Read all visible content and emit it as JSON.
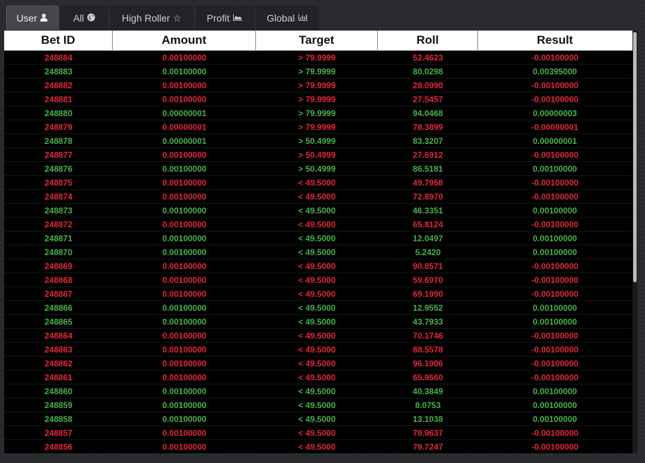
{
  "tabs": [
    {
      "label": "User",
      "icon": "user-icon",
      "active": true
    },
    {
      "label": "All",
      "icon": "globe-icon",
      "active": false
    },
    {
      "label": "High Roller",
      "icon": "star-icon",
      "active": false
    },
    {
      "label": "Profit",
      "icon": "area-chart-icon",
      "active": false
    },
    {
      "label": "Global",
      "icon": "bar-chart-icon",
      "active": false
    }
  ],
  "table": {
    "headers": [
      "Bet ID",
      "Amount",
      "Target",
      "Roll",
      "Result"
    ],
    "rows": [
      {
        "id": "248884",
        "amount": "0.00100000",
        "target": "> 79.9999",
        "roll": "52.4623",
        "result": "-0.00100000",
        "status": "loss"
      },
      {
        "id": "248883",
        "amount": "0.00100000",
        "target": "> 79.9999",
        "roll": "80.0298",
        "result": "0.00395000",
        "status": "win"
      },
      {
        "id": "248882",
        "amount": "0.00100000",
        "target": "> 79.9999",
        "roll": "28.0990",
        "result": "-0.00100000",
        "status": "loss"
      },
      {
        "id": "248881",
        "amount": "0.00100000",
        "target": "> 79.9999",
        "roll": "27.5457",
        "result": "-0.00100000",
        "status": "loss"
      },
      {
        "id": "248880",
        "amount": "0.00000001",
        "target": "> 79.9999",
        "roll": "94.0468",
        "result": "0.00000003",
        "status": "win"
      },
      {
        "id": "248879",
        "amount": "0.00000001",
        "target": "> 79.9999",
        "roll": "78.3899",
        "result": "-0.00000001",
        "status": "loss"
      },
      {
        "id": "248878",
        "amount": "0.00000001",
        "target": "> 50.4999",
        "roll": "83.3207",
        "result": "0.00000001",
        "status": "win"
      },
      {
        "id": "248877",
        "amount": "0.00100000",
        "target": "> 50.4999",
        "roll": "27.6912",
        "result": "-0.00100000",
        "status": "loss"
      },
      {
        "id": "248876",
        "amount": "0.00100000",
        "target": "> 50.4999",
        "roll": "86.5181",
        "result": "0.00100000",
        "status": "win"
      },
      {
        "id": "248875",
        "amount": "0.00100000",
        "target": "< 49.5000",
        "roll": "49.7958",
        "result": "-0.00100000",
        "status": "loss"
      },
      {
        "id": "248874",
        "amount": "0.00100000",
        "target": "< 49.5000",
        "roll": "72.8970",
        "result": "-0.00100000",
        "status": "loss"
      },
      {
        "id": "248873",
        "amount": "0.00100000",
        "target": "< 49.5000",
        "roll": "46.3351",
        "result": "0.00100000",
        "status": "win"
      },
      {
        "id": "248872",
        "amount": "0.00100000",
        "target": "< 49.5000",
        "roll": "65.8124",
        "result": "-0.00100000",
        "status": "loss"
      },
      {
        "id": "248871",
        "amount": "0.00100000",
        "target": "< 49.5000",
        "roll": "12.0497",
        "result": "0.00100000",
        "status": "win"
      },
      {
        "id": "248870",
        "amount": "0.00100000",
        "target": "< 49.5000",
        "roll": "5.2420",
        "result": "0.00100000",
        "status": "win"
      },
      {
        "id": "248869",
        "amount": "0.00100000",
        "target": "< 49.5000",
        "roll": "90.8571",
        "result": "-0.00100000",
        "status": "loss"
      },
      {
        "id": "248868",
        "amount": "0.00100000",
        "target": "< 49.5000",
        "roll": "59.6970",
        "result": "-0.00100000",
        "status": "loss"
      },
      {
        "id": "248867",
        "amount": "0.00100000",
        "target": "< 49.5000",
        "roll": "69.1990",
        "result": "-0.00100000",
        "status": "loss"
      },
      {
        "id": "248866",
        "amount": "0.00100000",
        "target": "< 49.5000",
        "roll": "12.9552",
        "result": "0.00100000",
        "status": "win"
      },
      {
        "id": "248865",
        "amount": "0.00100000",
        "target": "< 49.5000",
        "roll": "43.7933",
        "result": "0.00100000",
        "status": "win"
      },
      {
        "id": "248864",
        "amount": "0.00100000",
        "target": "< 49.5000",
        "roll": "70.1746",
        "result": "-0.00100000",
        "status": "loss"
      },
      {
        "id": "248863",
        "amount": "0.00100000",
        "target": "< 49.5000",
        "roll": "88.5578",
        "result": "-0.00100000",
        "status": "loss"
      },
      {
        "id": "248862",
        "amount": "0.00100000",
        "target": "< 49.5000",
        "roll": "96.1906",
        "result": "-0.00100000",
        "status": "loss"
      },
      {
        "id": "248861",
        "amount": "0.00100000",
        "target": "< 49.5000",
        "roll": "65.9560",
        "result": "-0.00100000",
        "status": "loss"
      },
      {
        "id": "248860",
        "amount": "0.00100000",
        "target": "< 49.5000",
        "roll": "40.3849",
        "result": "0.00100000",
        "status": "win"
      },
      {
        "id": "248859",
        "amount": "0.00100000",
        "target": "< 49.5000",
        "roll": "8.0753",
        "result": "0.00100000",
        "status": "win"
      },
      {
        "id": "248858",
        "amount": "0.00100000",
        "target": "< 49.5000",
        "roll": "13.1038",
        "result": "0.00100000",
        "status": "win"
      },
      {
        "id": "248857",
        "amount": "0.00100000",
        "target": "< 49.5000",
        "roll": "79.9637",
        "result": "-0.00100000",
        "status": "loss"
      },
      {
        "id": "248856",
        "amount": "0.00100000",
        "target": "< 49.5000",
        "roll": "79.7247",
        "result": "-0.00100000",
        "status": "loss"
      }
    ]
  },
  "colors": {
    "win": "#4ab04a",
    "loss": "#e0283a",
    "header_bg": "#ffffff",
    "table_bg": "#000000"
  }
}
